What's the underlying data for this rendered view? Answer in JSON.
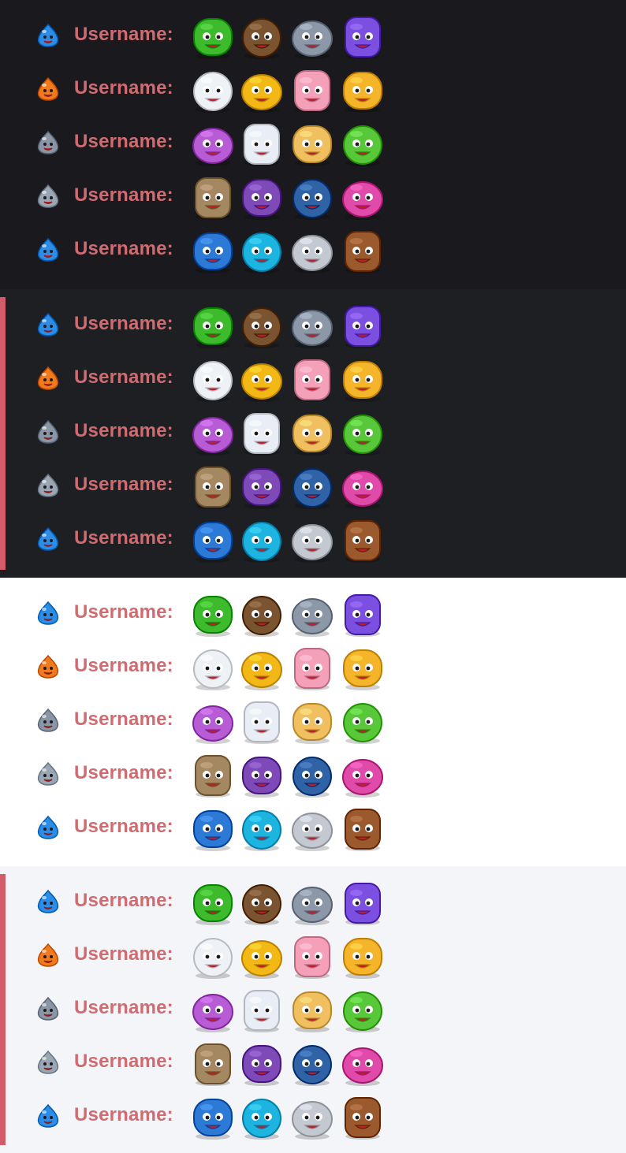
{
  "label": "Username:",
  "accent_color": "#d25d68",
  "text_color": "#cf6c72",
  "themes": [
    {
      "name": "dark",
      "background": "#1a1a1e",
      "highlighted": false
    },
    {
      "name": "dark-highlight",
      "background": "#1e1f23",
      "highlighted": true
    },
    {
      "name": "light",
      "background": "#ffffff",
      "highlighted": false
    },
    {
      "name": "light-highlight",
      "background": "#f4f5f8",
      "highlighted": true
    }
  ],
  "rows": [
    {
      "badge": "slime-blue-icon",
      "badge_color": "#2d8de6",
      "emojis": [
        {
          "icon": "green-slime-icon",
          "color": "#3dbb2c"
        },
        {
          "icon": "spiky-green-monster-icon",
          "color": "#7a5430"
        },
        {
          "icon": "crowned-king-slime-icon",
          "color": "#8c98a8"
        },
        {
          "icon": "purple-ghost-icon",
          "color": "#7b4fe0"
        }
      ]
    },
    {
      "badge": "slime-orange-icon",
      "badge_color": "#f07a1c",
      "emojis": [
        {
          "icon": "penguin-bird-icon",
          "color": "#eef1f6"
        },
        {
          "icon": "witch-hat-slime-icon",
          "color": "#f2b816"
        },
        {
          "icon": "pink-cat-icon",
          "color": "#f4a0b8"
        },
        {
          "icon": "tiger-face-icon",
          "color": "#f5b52a"
        }
      ]
    },
    {
      "badge": "slime-gray-icon",
      "badge_color": "#8a96a6",
      "emojis": [
        {
          "icon": "purple-masked-egg-icon",
          "color": "#b85cd6"
        },
        {
          "icon": "white-lion-icon",
          "color": "#e9edf5"
        },
        {
          "icon": "taco-face-icon",
          "color": "#f0c060"
        },
        {
          "icon": "frog-slug-icon",
          "color": "#58c83a"
        }
      ]
    },
    {
      "badge": "slime-steel-icon",
      "badge_color": "#9aa6b4",
      "emojis": [
        {
          "icon": "zombie-face-icon",
          "color": "#a48862"
        },
        {
          "icon": "purple-bat-icon",
          "color": "#7d4ab8"
        },
        {
          "icon": "blue-fuzzy-monster-icon",
          "color": "#2f63a6"
        },
        {
          "icon": "pink-dragon-icon",
          "color": "#e04aa8"
        }
      ]
    },
    {
      "badge": "slime-blue-crown-icon",
      "badge_color": "#2d8de6",
      "emojis": [
        {
          "icon": "blue-eyeball-monster-icon",
          "color": "#2d7ad6"
        },
        {
          "icon": "cyan-cyclops-icon",
          "color": "#1eb4e0"
        },
        {
          "icon": "gray-wolf-icon",
          "color": "#c4c8d0"
        },
        {
          "icon": "wooden-box-icon",
          "color": "#9a5a2e"
        }
      ]
    }
  ]
}
